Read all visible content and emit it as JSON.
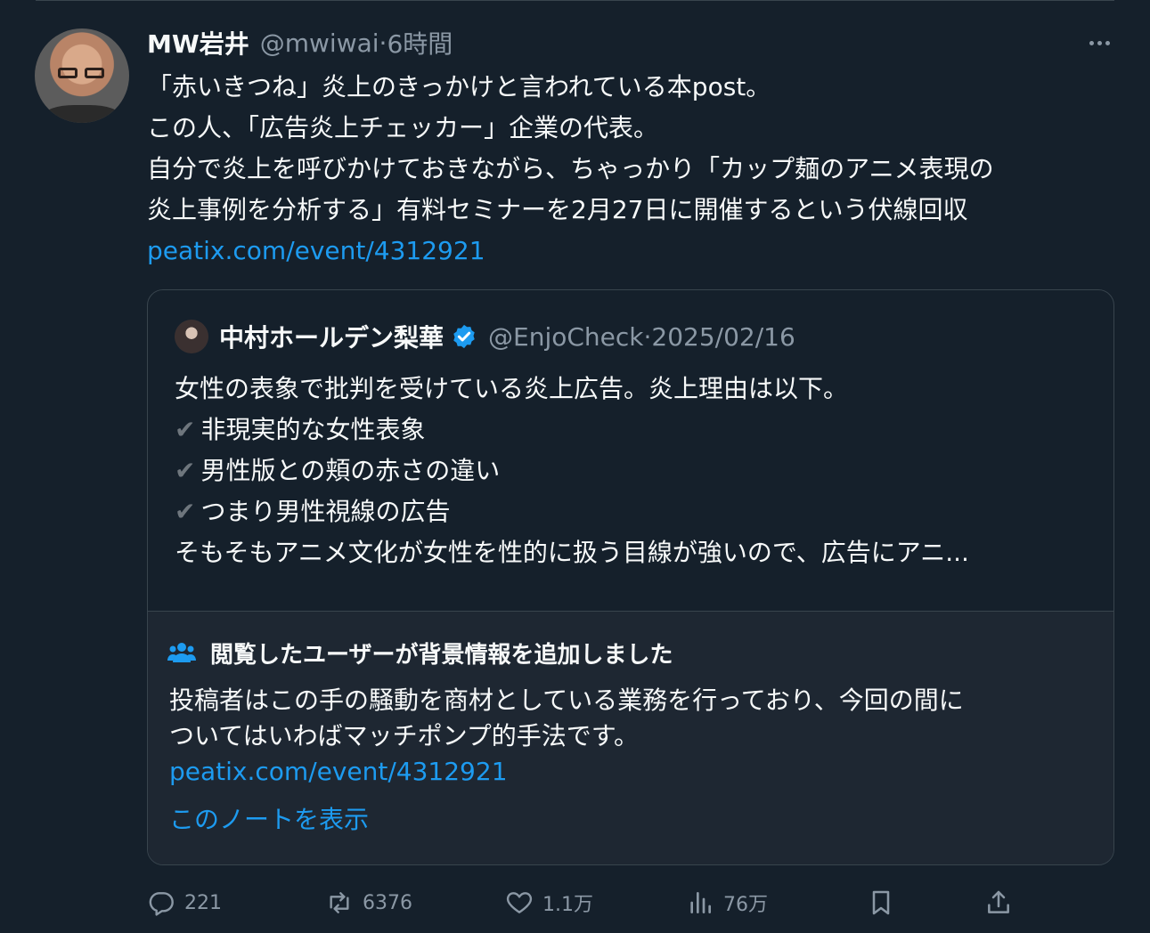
{
  "tweet": {
    "author_name": "MW岩井",
    "handle": "@mwiwai",
    "separator": "·",
    "time": "6時間",
    "lines": [
      "「赤いきつね」炎上のきっかけと言われている本post。",
      "この人、「広告炎上チェッカー」企業の代表。",
      "自分で炎上を呼びかけておきながら、ちゃっかり「カップ麺のアニメ表現の",
      "炎上事例を分析する」有料セミナーを2月27日に開催するという伏線回収"
    ],
    "link": "peatix.com/event/4312921"
  },
  "quote": {
    "author_name": "中村ホールデン梨華",
    "handle": "@EnjoCheck",
    "separator": "·",
    "date": "2025/02/16",
    "intro": "女性の表象で批判を受けている炎上広告。炎上理由は以下。",
    "check_glyph": "✔",
    "bullets": [
      "非現実的な女性表象",
      "男性版との頬の赤さの違い",
      "つまり男性視線の広告"
    ],
    "continuation": "そもそもアニメ文化が女性を性的に扱う目線が強いので、広告にアニ..."
  },
  "note": {
    "title": "閲覧したユーザーが背景情報を追加しました",
    "lines": [
      "投稿者はこの手の騒動を商材としている業務を行っており、今回の間に",
      "ついてはいわばマッチポンプ的手法です。"
    ],
    "link": "peatix.com/event/4312921",
    "show_label": "このノートを表示"
  },
  "actions": {
    "replies": "221",
    "reposts": "6376",
    "likes": "1.1万",
    "views": "76万"
  },
  "colors": {
    "background": "#15202b",
    "link": "#1d9bf0",
    "muted": "#8b98a5",
    "border": "#38444d"
  }
}
